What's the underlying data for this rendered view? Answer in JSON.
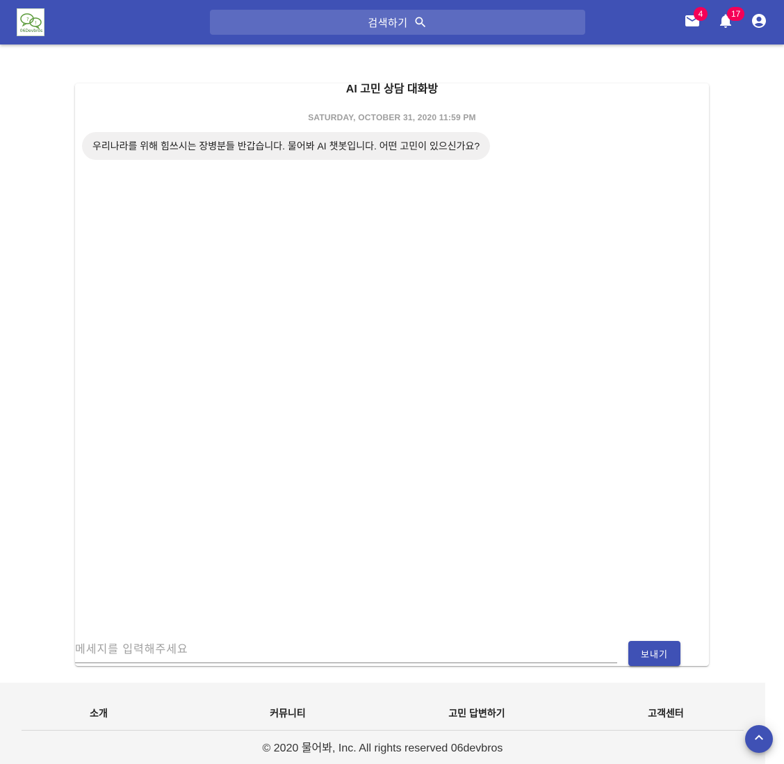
{
  "header": {
    "logo_text": "06Devbros",
    "search_label": "검색하기",
    "mail_badge": "4",
    "notifications_badge": "17"
  },
  "chat": {
    "title": "AI 고민 상담 대화방",
    "timestamp": "SATURDAY, OCTOBER 31, 2020 11:59 PM",
    "messages": [
      {
        "text": "우리나라를 위해 힘쓰시는 장병분들 반갑습니다. 물어봐 AI 챗봇입니다. 어떤 고민이 있으신가요?"
      }
    ],
    "input_placeholder": "메세지를 입력해주세요",
    "input_value": "",
    "send_label": "보내기"
  },
  "footer": {
    "links": [
      "소개",
      "커뮤니티",
      "고민 답변하기",
      "고객센터"
    ],
    "copyright": "© 2020 물어봐, Inc. All rights reserved 06devbros"
  },
  "colors": {
    "primary": "#3f51b5",
    "search_bg": "#5c6bc0",
    "badge": "#f50057"
  },
  "icons": [
    "mail-icon",
    "bell-icon",
    "account-circle-icon",
    "search-icon",
    "chevron-up-icon"
  ]
}
